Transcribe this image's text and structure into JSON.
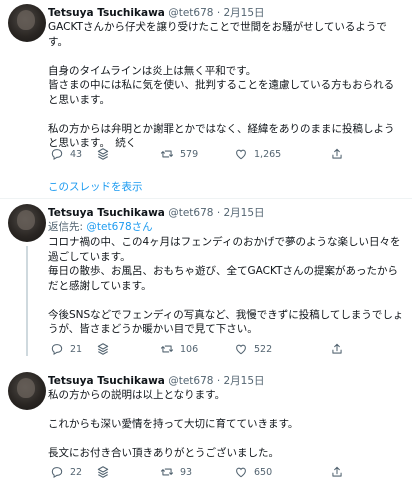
{
  "tweets": [
    {
      "name": "Tetsuya Tsuchikawa",
      "handle": "@tet678",
      "date": "2月15日",
      "body": [
        "GACKTさんから仔犬を譲り受けたことで世間をお騒がせしているようで\nす。",
        "自身のタイムラインは炎上は無く平和です。\n皆さまの中には私に気を使い、批判することを遠慮している方もおられる\nと思います。",
        "私の方からは弁明とか謝罪とかではなく、経緯をありのままに投稿しよう\nと思います。　続く"
      ],
      "replies": "43",
      "retweets": "579",
      "likes": "1,265"
    },
    {
      "name": "Tetsuya Tsuchikawa",
      "handle": "@tet678",
      "date": "2月15日",
      "reply_prefix": "返信先:",
      "reply_handle": "@tet678さん",
      "body": [
        "コロナ禍の中、この4ヶ月はフェンディのおかげで夢のような楽しい日々を\n過ごしています。\n毎日の散歩、お風呂、おもちゃ遊び、全てGACKTさんの提案があったから\nだと感謝しています。",
        "今後SNSなどでフェンディの写真など、我慢できずに投稿してしまうでしょ\nうが、皆さまどうか暖かい目で見て下さい。"
      ],
      "replies": "21",
      "retweets": "106",
      "likes": "522"
    },
    {
      "name": "Tetsuya Tsuchikawa",
      "handle": "@tet678",
      "date": "2月15日",
      "body": [
        "私の方からの説明は以上となります。",
        "これからも深い愛情を持って大切に育てていきます。",
        "長文にお付き合い頂きありがとうございました。"
      ],
      "replies": "22",
      "retweets": "93",
      "likes": "650"
    }
  ],
  "show_thread": "このスレッドを表示",
  "separator": "·",
  "icons": [
    "reply-icon",
    "retweet-icon",
    "like-icon",
    "share-icon"
  ],
  "colors": {
    "link": "#1d9bf0",
    "muted": "#536471",
    "text": "#0f1419"
  }
}
